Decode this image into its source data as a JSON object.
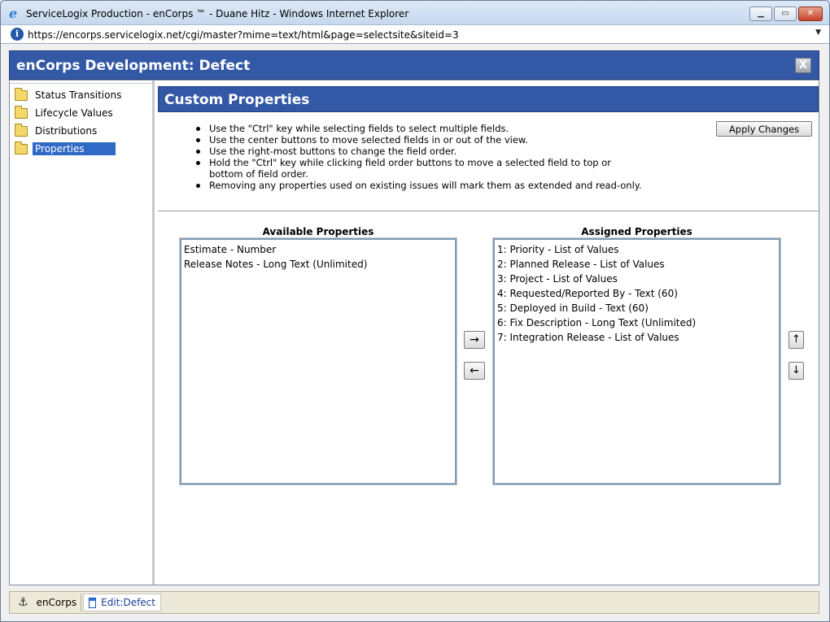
{
  "window": {
    "title": "ServiceLogix Production - enCorps ™ - Duane Hitz - Windows Internet Explorer",
    "minimize": "▁",
    "maximize": "▭",
    "close": "✕"
  },
  "address": {
    "url": "https://encorps.servicelogix.net/cgi/master?mime=text/html&page=selectsite&siteid=3",
    "dropdown": "▼"
  },
  "app": {
    "title": "enCorps Development: Defect",
    "close_label": "X"
  },
  "sidebar": {
    "items": [
      {
        "label": "Status Transitions"
      },
      {
        "label": "Lifecycle Values"
      },
      {
        "label": "Distributions"
      },
      {
        "label": "Properties",
        "selected": true
      }
    ]
  },
  "content": {
    "title": "Custom Properties",
    "apply_label": "Apply Changes",
    "instructions": [
      "Use the \"Ctrl\" key while selecting fields to select multiple fields.",
      "Use the center buttons to move selected fields in or out of the view.",
      "Use the right-most buttons to change the field order.",
      "Hold the \"Ctrl\" key while clicking field order buttons to move a selected field to top or bottom of field order.",
      "Removing any properties used on existing issues will mark them as extended and read-only."
    ],
    "available": {
      "label": "Available Properties",
      "options": [
        "Estimate - Number",
        "Release Notes - Long Text (Unlimited)"
      ]
    },
    "assigned": {
      "label": "Assigned Properties",
      "options": [
        "1: Priority - List of Values",
        "2: Planned Release - List of Values",
        "3: Project - List of Values",
        "4: Requested/Reported By - Text (60)",
        "5: Deployed in Build - Text (60)",
        "6: Fix Description - Long Text (Unlimited)",
        "7: Integration Release - List of Values"
      ]
    },
    "move_right": "→",
    "move_left": "←",
    "move_up": "↑",
    "move_down": "↓"
  },
  "taskbar": {
    "items": [
      {
        "label": "enCorps",
        "icon": "anchor-icon"
      },
      {
        "label": "Edit:Defect",
        "icon": "window-icon"
      }
    ]
  }
}
